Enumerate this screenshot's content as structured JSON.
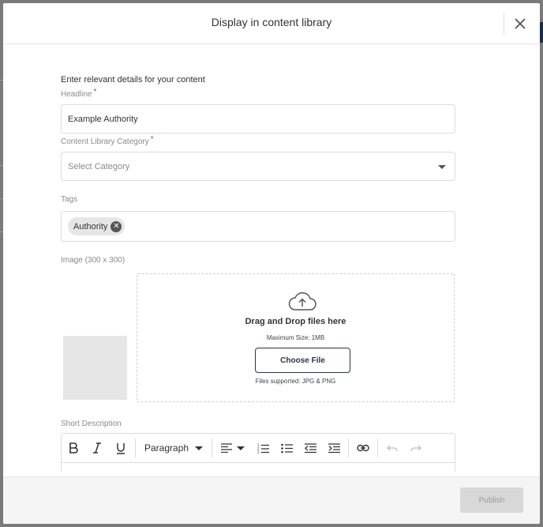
{
  "modal": {
    "title": "Display in content library",
    "intro": "Enter relevant details for your content"
  },
  "fields": {
    "headline_label": "Headline",
    "headline_value": "Example Authority",
    "category_label": "Content Library Category",
    "category_placeholder": "Select Category",
    "tags_label": "Tags",
    "tags": [
      "Authority"
    ],
    "image_label": "Image (300 x 300)",
    "required_marker": "*"
  },
  "dropzone": {
    "title": "Drag and Drop files here",
    "max_size": "Maximum Size: 1MB",
    "button": "Choose File",
    "supported": "Files supported: JPG & PNG"
  },
  "editor": {
    "label": "Short Description",
    "block_format": "Paragraph",
    "tools": [
      "bold-icon",
      "italic-icon",
      "underline-icon",
      "align-left-icon",
      "numbered-list-icon",
      "bullet-list-icon",
      "outdent-icon",
      "indent-icon",
      "link-icon",
      "undo-icon",
      "redo-icon"
    ]
  },
  "footer": {
    "publish_label": "Publish"
  },
  "colors": {
    "primary": "#26354f",
    "required": "#e53935",
    "disabled_bg": "#d8d8d8"
  }
}
